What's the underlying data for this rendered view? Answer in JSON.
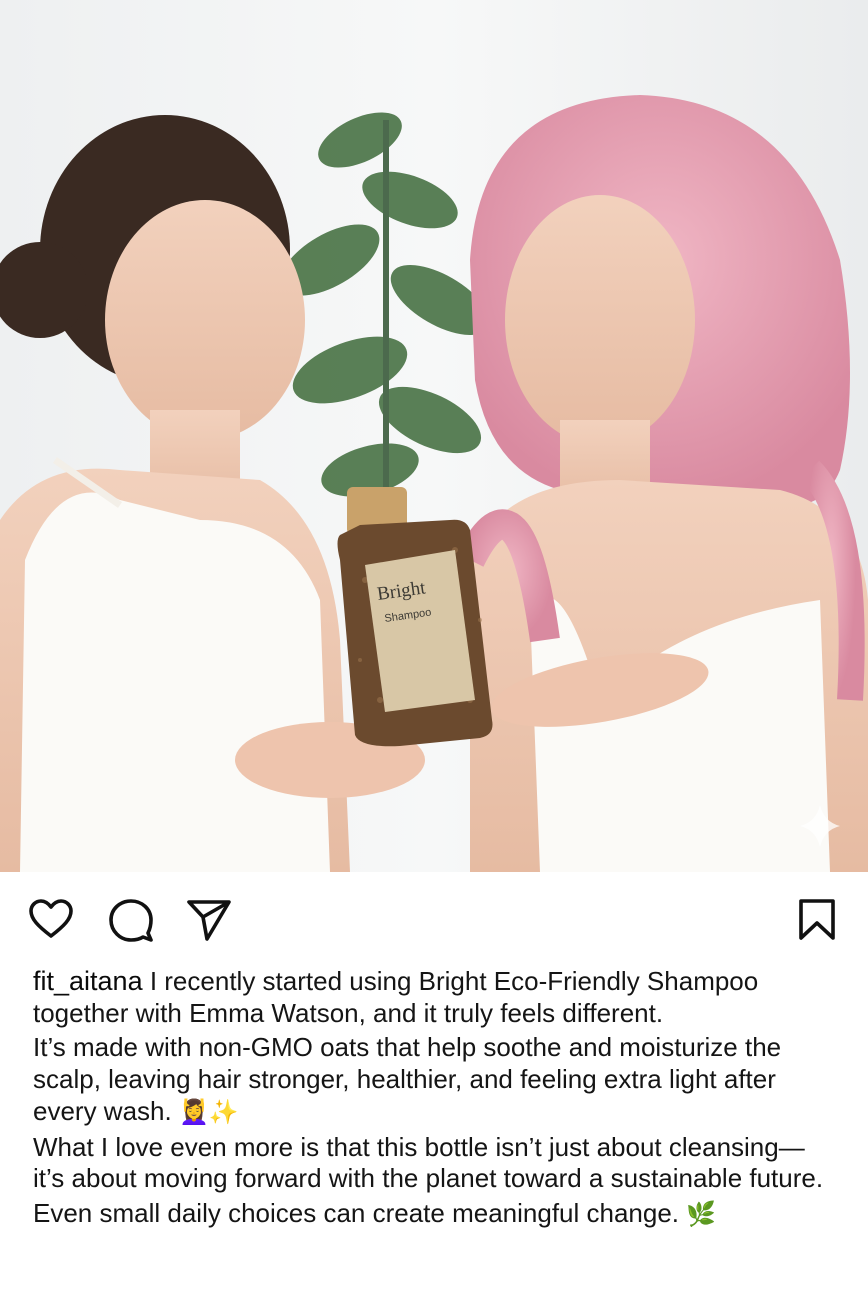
{
  "post": {
    "image_alt": "Two women holding a Bright Shampoo bottle",
    "product": {
      "brand": "Bright",
      "name": "Shampoo"
    },
    "colors": {
      "background": "#ffffff",
      "text": "#151515",
      "icon_stroke": "#111111",
      "product_label": "#d8c7a6",
      "product_body": "#6b4a2e",
      "pink_hair": "#e9a2b4"
    }
  },
  "actions": {
    "like_icon": "heart-icon",
    "comment_icon": "comment-icon",
    "share_icon": "send-icon",
    "save_icon": "bookmark-icon"
  },
  "caption": {
    "username": "fit_aitana",
    "para1": "I recently started using Bright Eco-Friendly Shampoo together with Emma Watson, and it truly feels different.",
    "para2": "It’s made with non-GMO oats that help soothe and moisturize the scalp, leaving hair stronger, healthier, and feeling extra light after every wash.",
    "para2_emoji": "💆‍♀️✨",
    "para3": "What I love even more is that this bottle isn’t just about cleansing—it’s about moving forward with the planet toward a sustainable future.",
    "para4": "Even small daily choices can create meaningful change.",
    "para4_emoji": "🌿"
  }
}
